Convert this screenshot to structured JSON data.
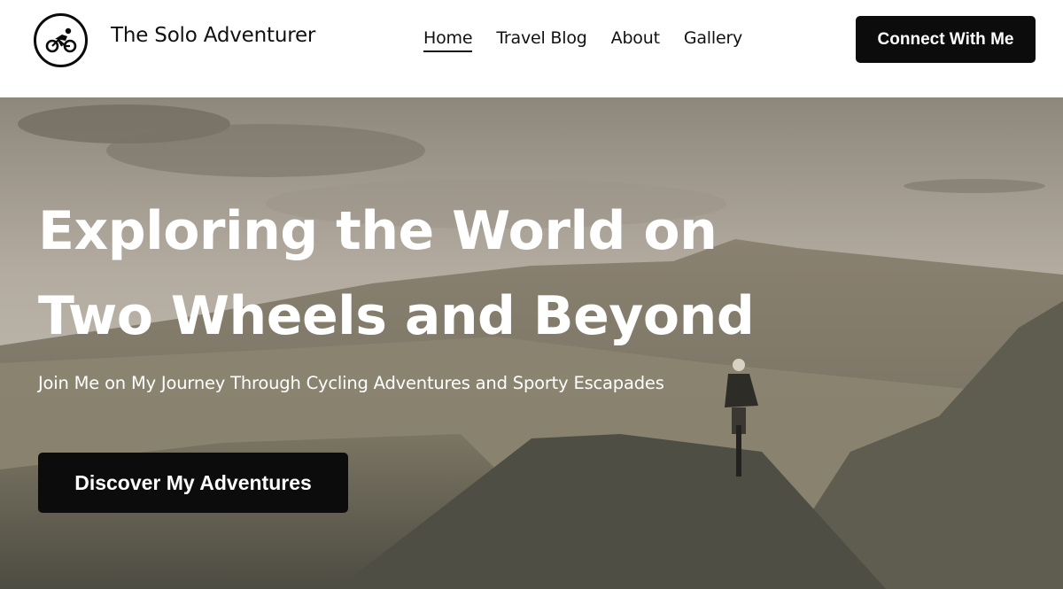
{
  "header": {
    "brand": "The Solo Adventurer",
    "logo_icon": "bicycle-rider-icon",
    "nav": [
      {
        "label": "Home",
        "active": true
      },
      {
        "label": "Travel Blog",
        "active": false
      },
      {
        "label": "About",
        "active": false
      },
      {
        "label": "Gallery",
        "active": false
      }
    ],
    "cta_label": "Connect With Me"
  },
  "hero": {
    "title_line1": "Exploring the World on",
    "title_line2": "Two Wheels and Beyond",
    "subtitle": "Join Me on My Journey Through Cycling Adventures and Sporty Escapades",
    "button_label": "Discover My Adventures",
    "background": "cyclist-on-mountain-road-photo"
  },
  "colors": {
    "button_bg": "#0c0c0c",
    "header_bg": "#ffffff",
    "hero_text": "#ffffff"
  }
}
